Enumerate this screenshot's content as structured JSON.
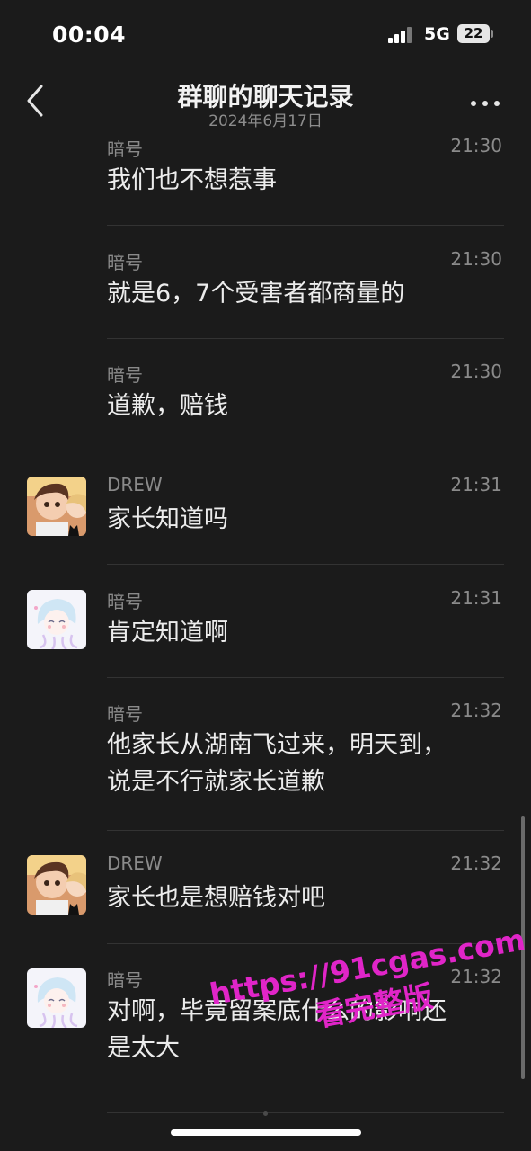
{
  "status": {
    "time": "00:04",
    "network": "5G",
    "battery": "22"
  },
  "header": {
    "title": "群聊的聊天记录",
    "date": "2024年6月17日"
  },
  "messages": [
    {
      "sender": "暗号",
      "time": "21:30",
      "lines": [
        "我们也不想惹事"
      ]
    },
    {
      "sender": "暗号",
      "time": "21:30",
      "lines": [
        "就是6，7个受害者都商量的"
      ]
    },
    {
      "sender": "暗号",
      "time": "21:30",
      "lines": [
        "道歉，赔钱"
      ]
    },
    {
      "sender": "DREW",
      "time": "21:31",
      "lines": [
        "家长知道吗"
      ]
    },
    {
      "sender": "暗号",
      "time": "21:31",
      "lines": [
        "肯定知道啊"
      ]
    },
    {
      "sender": "暗号",
      "time": "21:32",
      "lines": [
        "他家长从湖南飞过来，明天到，",
        "说是不行就家长道歉"
      ]
    },
    {
      "sender": "DREW",
      "time": "21:32",
      "lines": [
        "家长也是想赔钱对吧"
      ]
    },
    {
      "sender": "暗号",
      "time": "21:32",
      "lines": [
        "对啊，毕竟留案底什么的影响还",
        "是太大"
      ]
    }
  ],
  "watermark": {
    "line1": "https://91cgas.com",
    "line2": "看完整版"
  },
  "icons": {
    "back": "chevron-left-icon",
    "more": "more-dots-icon"
  }
}
